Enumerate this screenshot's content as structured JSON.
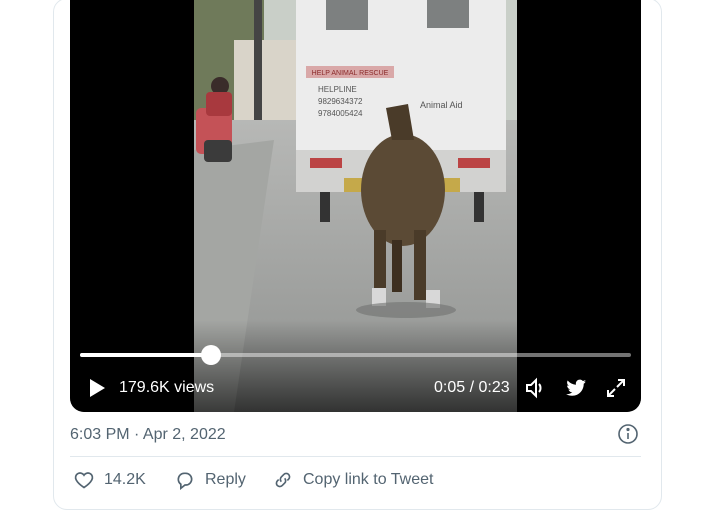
{
  "video": {
    "views": "179.6K views",
    "time": "0:05 / 0:23",
    "progress": 0.2377,
    "truck_text": {
      "banner": "HELP ANIMAL RESCUE",
      "helpline": "HELPLINE",
      "phone1": "9829634372",
      "phone2": "9784005424",
      "org": "Animal Aid"
    }
  },
  "tweet": {
    "timestamp": "6:03 PM · Apr 2, 2022"
  },
  "actions": {
    "likes": "14.2K",
    "reply": "Reply",
    "copy_link": "Copy link to Tweet"
  },
  "colors": {
    "muted_text": "#536471",
    "border": "#e1e8ed",
    "heart_outline": "#536471"
  }
}
